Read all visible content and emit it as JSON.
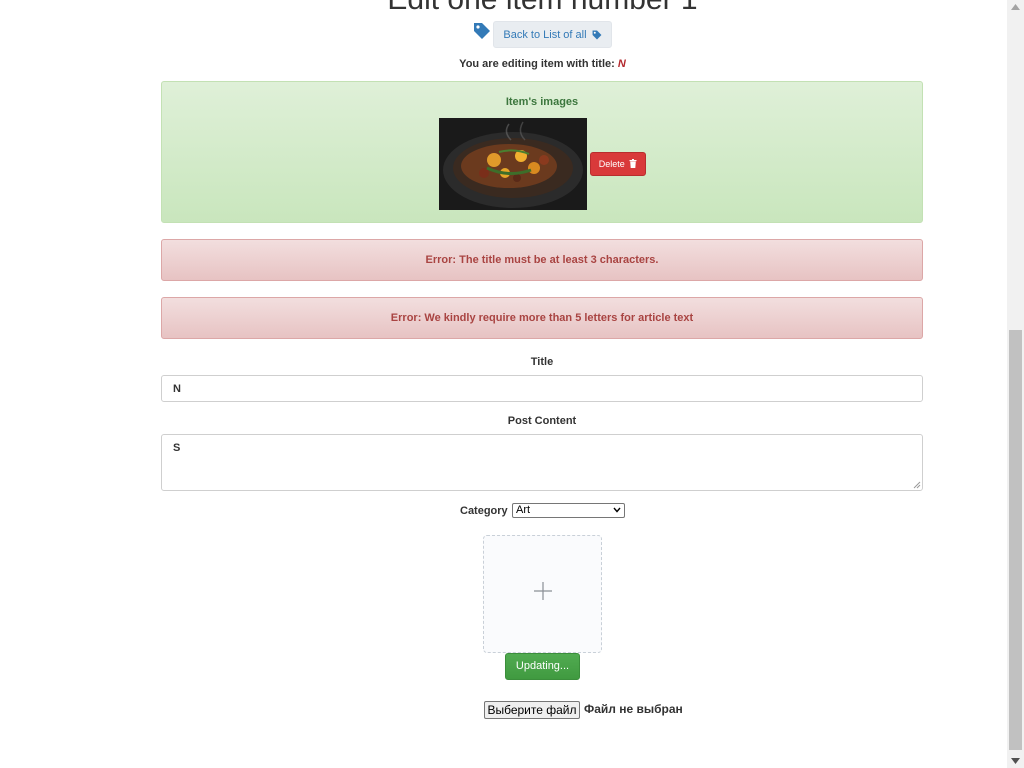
{
  "page": {
    "heading": "Edit one item number 1",
    "back_button": "Back to List of all",
    "editing_prefix": "You are editing item with title:",
    "editing_title": "N"
  },
  "images_panel": {
    "title": "Item's images",
    "delete_button": "Delete"
  },
  "errors": [
    "Error: The title must be at least 3 characters.",
    "Error: We kindly require more than 5 letters for article text"
  ],
  "form": {
    "title_label": "Title",
    "title_value": "N",
    "content_label": "Post Content",
    "content_value": "S",
    "category_label": "Category",
    "category_selected": "Art",
    "submit_button": "Updating...",
    "file_button": "Выберите файл",
    "file_status": "Файл не выбран"
  },
  "icons": {
    "tag": "tag-icon",
    "trash": "trash-icon",
    "plus": "plus-icon"
  },
  "colors": {
    "link": "#337ab7",
    "success_bg": "#dff0d8",
    "danger_bg": "#f2dede",
    "danger_text": "#a94442",
    "delete_button": "#d9393a",
    "submit_button": "#4cae4c"
  }
}
